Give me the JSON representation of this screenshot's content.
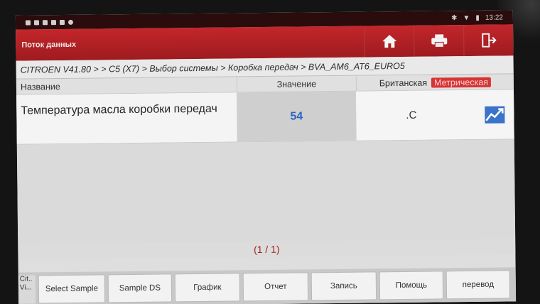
{
  "status": {
    "time": "13:22"
  },
  "header": {
    "title": "Поток данных"
  },
  "breadcrumb": "CITROEN V41.80 > > C5 (X7) > Выбор системы > Коробка передач > BVA_AM6_AT6_EURO5",
  "table": {
    "headers": {
      "name": "Название",
      "value": "Значение",
      "unit_british": "Британская",
      "unit_metric": "Метрическая"
    },
    "rows": [
      {
        "name": "Температура масла коробки передач",
        "value": "54",
        "unit": ".C"
      }
    ]
  },
  "pager": "(1 / 1)",
  "toolbar": {
    "truncated_line1": "Cit..",
    "truncated_line2": "Vi...",
    "select_sample": "Select Sample",
    "sample_ds": "Sample DS",
    "graph": "График",
    "report": "Отчет",
    "record": "Запись",
    "help": "Помощь",
    "translate": "перевод"
  },
  "colors": {
    "title_bar": "#b52126",
    "value_text": "#2b64c4",
    "active_unit": "#d63434"
  },
  "icons": [
    "home-icon",
    "print-icon",
    "exit-icon",
    "graph-trend-icon"
  ]
}
